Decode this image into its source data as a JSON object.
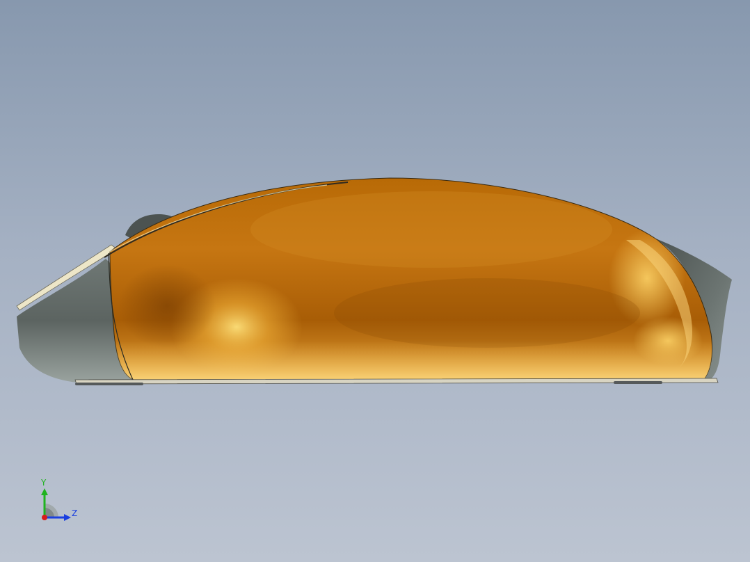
{
  "triad": {
    "y_label": "Y",
    "z_label": "Z",
    "colors": {
      "y_axis": "#1fb31f",
      "z_axis": "#1a3fe0",
      "x_axis": "#d81c1c"
    }
  },
  "model": {
    "colors": {
      "shell_main": "#c8780e",
      "shell_highlight": "#f7c24a",
      "shell_dark": "#8f4e05",
      "rubber_grey": "#5d6562",
      "rubber_dark": "#3e4442",
      "trim_cream": "#ede6c8"
    }
  }
}
